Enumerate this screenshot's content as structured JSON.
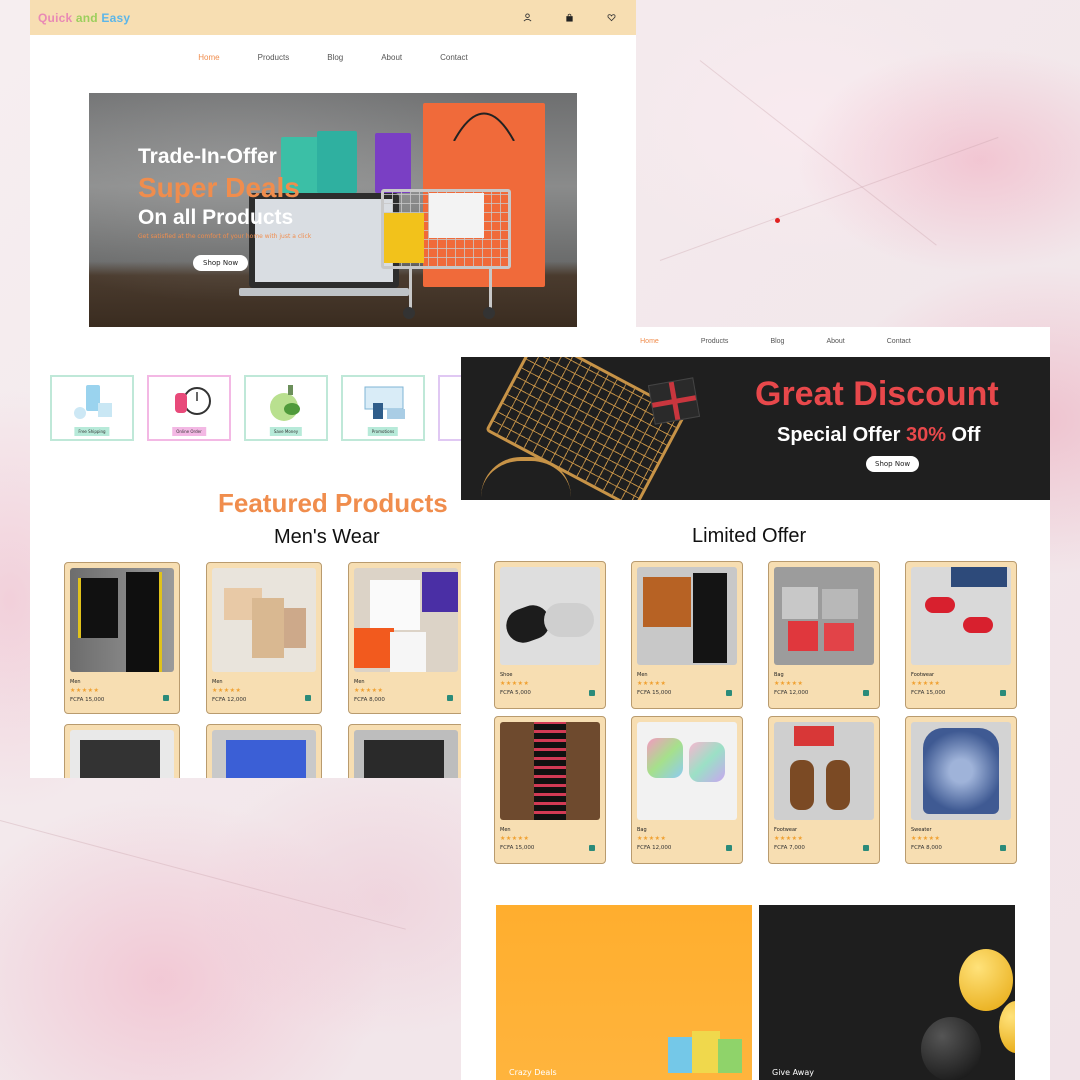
{
  "page1": {
    "logo": {
      "part1": "Quick",
      "part2": "and",
      "part3": "Easy"
    },
    "icons": [
      "user-icon",
      "bag-icon",
      "heart-icon"
    ],
    "nav": [
      "Home",
      "Products",
      "Blog",
      "About",
      "Contact"
    ],
    "hero": {
      "line1": "Trade-In-Offer",
      "line2": "Super Deals",
      "line3": "On all Products",
      "tagline": "Get satisfied at the comfort of your home with just a click",
      "button": "Shop Now"
    },
    "features": [
      "Free Shipping",
      "Online Order",
      "Save Money",
      "Promotions"
    ],
    "featured_title": "Featured Products",
    "section_title": "Men's Wear",
    "products": [
      {
        "name": "Men",
        "stars": "★★★★★",
        "price": "FCFA 15,000"
      },
      {
        "name": "Men",
        "stars": "★★★★★",
        "price": "FCFA 12,000"
      },
      {
        "name": "Men",
        "stars": "★★★★★",
        "price": "FCFA 8,000"
      }
    ]
  },
  "page2": {
    "nav": [
      "Home",
      "Products",
      "Blog",
      "About",
      "Contact"
    ],
    "hero": {
      "title": "Great Discount",
      "subtitle_a": "Special Offer",
      "subtitle_pct": "30%",
      "subtitle_b": "Off",
      "button": "Shop Now"
    },
    "section_title": "Limited Offer",
    "products": [
      {
        "name": "Shoe",
        "stars": "★★★★★",
        "price": "FCFA 5,000"
      },
      {
        "name": "Men",
        "stars": "★★★★★",
        "price": "FCFA 15,000"
      },
      {
        "name": "Bag",
        "stars": "★★★★★",
        "price": "FCFA 12,000"
      },
      {
        "name": "Footwear",
        "stars": "★★★★★",
        "price": "FCFA 15,000"
      },
      {
        "name": "Men",
        "stars": "★★★★★",
        "price": "FCFA 15,000"
      },
      {
        "name": "Bag",
        "stars": "★★★★★",
        "price": "FCFA 12,000"
      },
      {
        "name": "Footwear",
        "stars": "★★★★★",
        "price": "FCFA 7,000"
      },
      {
        "name": "Sweater",
        "stars": "★★★★★",
        "price": "FCFA 8,000"
      }
    ],
    "banners": [
      "Crazy Deals",
      "Give Away"
    ]
  },
  "colors": {
    "accent": "#f08d4d",
    "header": "#f7deb2",
    "discount_red": "#e8484b",
    "card": "#f7deb2"
  }
}
